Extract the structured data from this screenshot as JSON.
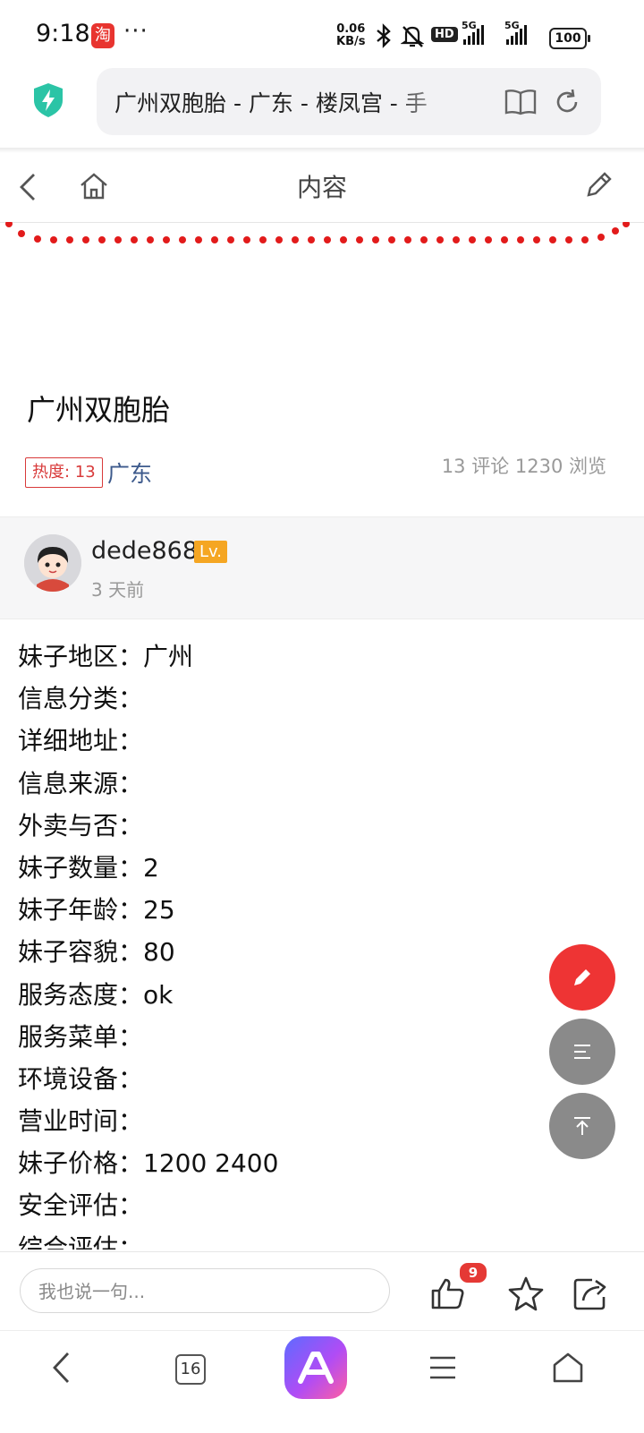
{
  "status_bar": {
    "time": "9:18",
    "app_icon": "淘",
    "more": "···",
    "net_speed_value": "0.06",
    "net_speed_unit": "KB/s",
    "hd_label": "HD",
    "signal1_label": "5G",
    "signal2_label": "5G",
    "battery": "100"
  },
  "address_bar": {
    "url_text": "广州双胞胎 - 广东 - 楼凤宫 - 手"
  },
  "nav": {
    "title": "内容"
  },
  "article": {
    "title": "广州双胞胎",
    "heat_label": "热度: 13",
    "region": "广东",
    "stats": "13 评论   1230 浏览"
  },
  "author": {
    "name": "dede868",
    "level": "Lv.",
    "time": "3 天前"
  },
  "fields": [
    {
      "label": "妹子地区：",
      "value": "广州"
    },
    {
      "label": "信息分类：",
      "value": ""
    },
    {
      "label": "详细地址：",
      "value": ""
    },
    {
      "label": "信息来源：",
      "value": ""
    },
    {
      "label": "外卖与否：",
      "value": ""
    },
    {
      "label": "妹子数量：",
      "value": "2"
    },
    {
      "label": "妹子年龄：",
      "value": "25"
    },
    {
      "label": "妹子容貌：",
      "value": "80"
    },
    {
      "label": "服务态度：",
      "value": "ok"
    },
    {
      "label": "服务菜单：",
      "value": ""
    },
    {
      "label": "环境设备：",
      "value": ""
    },
    {
      "label": "营业时间：",
      "value": ""
    },
    {
      "label": "妹子价格：",
      "value": "1200 2400"
    },
    {
      "label": "安全评估：",
      "value": ""
    },
    {
      "label": "综合评估：",
      "value": ""
    }
  ],
  "comment_bar": {
    "placeholder": "我也说一句...",
    "like_count": "9"
  },
  "bottom_nav": {
    "tab_count": "16"
  },
  "colors": {
    "accent_red": "#ee3434",
    "fab_gray": "#8a8a8a",
    "region_link": "#3d5a8c",
    "shield": "#2bc4a6"
  }
}
